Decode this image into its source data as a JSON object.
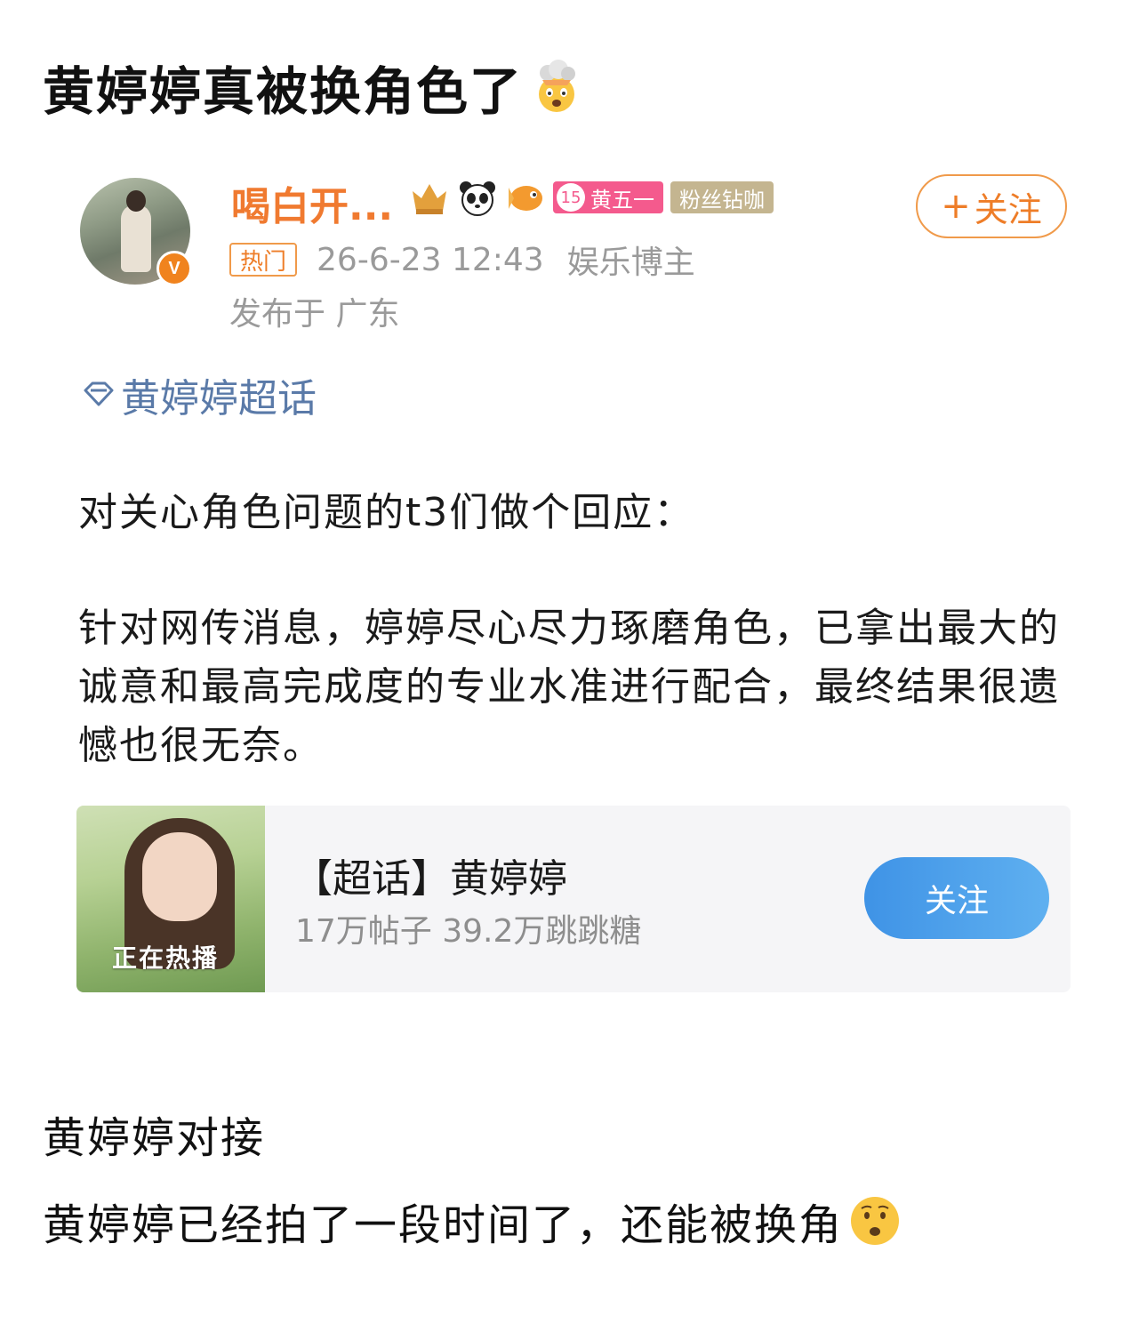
{
  "post": {
    "title": "黄婷婷真被换角色了"
  },
  "card": {
    "username": "喝白开...",
    "fan_level": "15",
    "fan_name": "黄五一",
    "fan_title": "粉丝钻咖",
    "follow_label": "关注",
    "follow_plus": "+",
    "hot_tag": "热门",
    "timestamp": "26-6-23 12:43",
    "role": "娱乐博主",
    "location": "发布于 广东",
    "verified_mark": "V",
    "topic_link": "黄婷婷超话",
    "para1": "对关心角色问题的t3们做个回应：",
    "para2": "针对网传消息，婷婷尽心尽力琢磨角色，已拿出最大的诚意和最高完成度的专业水准进行配合，最终结果很遗憾也很无奈。",
    "topic_card": {
      "name": "【超话】黄婷婷",
      "stats": "17万帖子 39.2万跳跳糖",
      "follow_label": "关注",
      "thumb_text": "正在热播"
    }
  },
  "extra": {
    "line1": "黄婷婷对接",
    "line2": "黄婷婷已经拍了一段时间了，还能被换角"
  },
  "colors": {
    "username": "#f07a30",
    "topic_link": "#5a7aa8",
    "follow_blue": "#3f93e6"
  }
}
